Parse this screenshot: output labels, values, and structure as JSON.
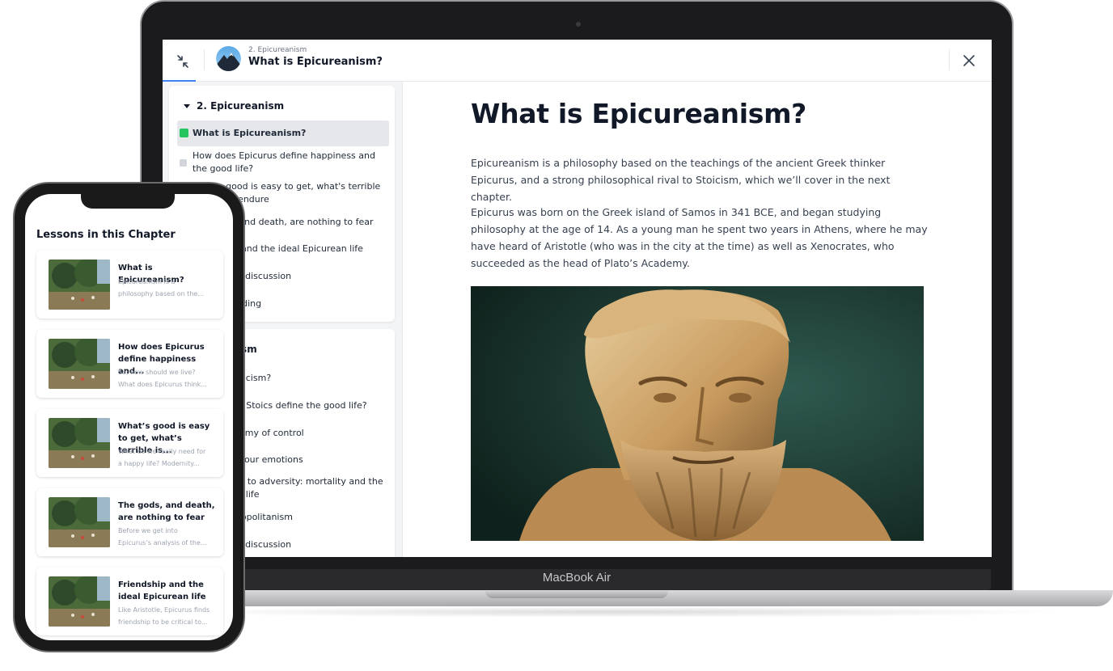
{
  "laptop": {
    "brand": "MacBook Air",
    "topbar": {
      "breadcrumb": "2. Epicureanism",
      "title": "What is Epicureanism?",
      "collapse_icon": "collapse-arrows-icon",
      "close_icon": "close-icon"
    },
    "sidebar": {
      "chapter1": {
        "title": "2. Epicureanism",
        "lessons": [
          "What is Epicureanism?",
          "How does Epicurus define happiness and the good life?",
          "What's good is easy to get, what's terrible is easy to endure",
          "The gods, and death, are nothing to fear",
          "Friendship and the ideal Epicurean life",
          "Essays and discussion",
          "Further reading"
        ]
      },
      "chapter2": {
        "title": "3. Stoicism",
        "lessons": [
          "What is Stoicism?",
          "How do the Stoics define the good life?",
          "The dichotomy of control",
          "Managing your emotions",
          "Responding to adversity: mortality and the meaning of life",
          "Stoic cosmopolitanism",
          "Essays and discussion"
        ]
      }
    },
    "article": {
      "heading": "What is Epicureanism?",
      "paragraphs": [
        "Epicureanism is a philosophy based on the teachings of the ancient Greek thinker Epicurus, and a strong philosophical rival to Stoicism, which we’ll cover in the next chapter.",
        "Epicurus was born on the Greek island of Samos in 341 BCE, and began studying philosophy at the age of 14. As a young man he spent two years in Athens, where he may have heard of Aristotle (who was in the city at the time) as well as Xenocrates, who succeeded as the head of Plato’s Academy."
      ],
      "image": "epicurus-bust-image"
    }
  },
  "phone": {
    "title": "Lessons in this Chapter",
    "cards": [
      {
        "title": "What is Epicureanism?",
        "excerpt": [
          "Epicureanism is a",
          "philosophy based on the..."
        ]
      },
      {
        "title": "How does Epicurus define happiness and...",
        "excerpt": [
          "So, how should we live?",
          "What does Epicurus think..."
        ]
      },
      {
        "title": "What’s good is easy to get, what’s terrible is...",
        "excerpt": [
          "What do we really need for",
          "a happy life? Modernity..."
        ]
      },
      {
        "title": "The gods, and death, are nothing to fear",
        "excerpt": [
          "Before we get into",
          "Epicurus’s analysis of the..."
        ]
      },
      {
        "title": "Friendship and the ideal Epicurean life",
        "excerpt": [
          "Like Aristotle, Epicurus finds",
          "friendship to be critical to..."
        ]
      }
    ]
  },
  "colors": {
    "accent": "#3b82f6",
    "active_lesson_icon": "#22c55e",
    "sidebar_bg": "#f3f4f6"
  }
}
